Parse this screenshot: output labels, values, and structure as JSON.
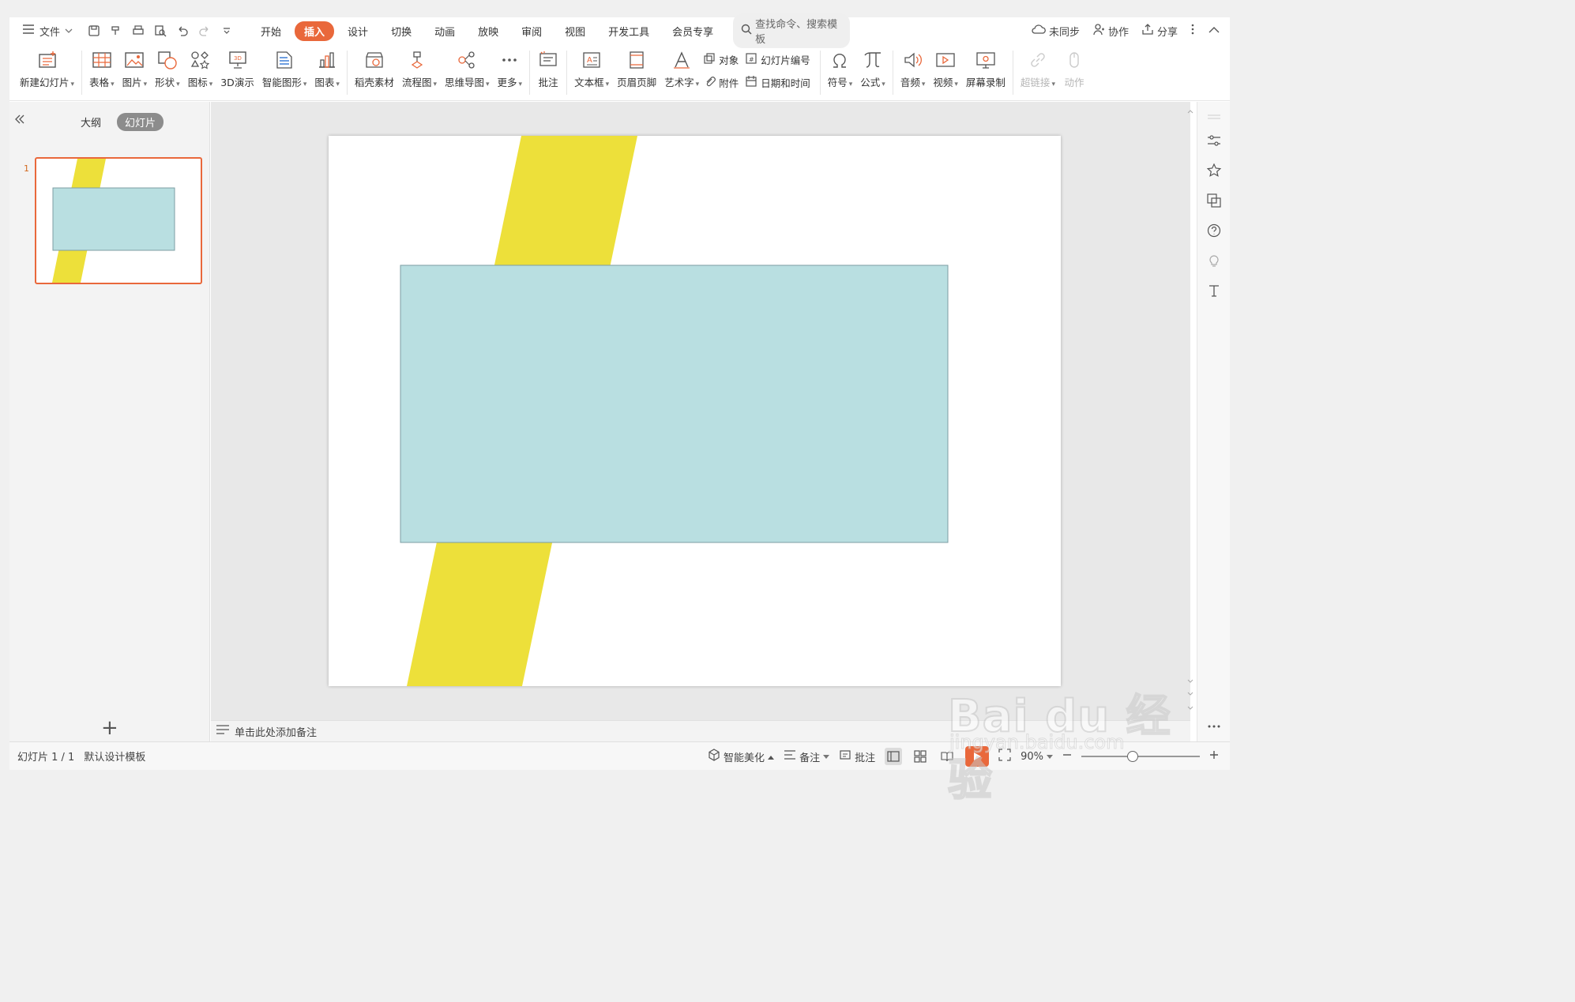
{
  "menubar": {
    "file_label": "文件",
    "tabs": [
      {
        "label": "开始",
        "active": false
      },
      {
        "label": "插入",
        "active": true
      },
      {
        "label": "设计",
        "active": false
      },
      {
        "label": "切换",
        "active": false
      },
      {
        "label": "动画",
        "active": false
      },
      {
        "label": "放映",
        "active": false
      },
      {
        "label": "审阅",
        "active": false
      },
      {
        "label": "视图",
        "active": false
      },
      {
        "label": "开发工具",
        "active": false
      },
      {
        "label": "会员专享",
        "active": false
      }
    ],
    "search_placeholder": "查找命令、搜索模板",
    "sync_label": "未同步",
    "collab_label": "协作",
    "share_label": "分享"
  },
  "ribbon": {
    "new_slide": "新建幻灯片",
    "table": "表格",
    "picture": "图片",
    "shape": "形状",
    "icon": "图标",
    "demo3d": "3D演示",
    "smartart": "智能图形",
    "chart": "图表",
    "material": "稻壳素材",
    "flowchart": "流程图",
    "mindmap": "思维导图",
    "more": "更多",
    "comment": "批注",
    "textbox": "文本框",
    "header_footer": "页眉页脚",
    "wordart": "艺术字",
    "object": "对象",
    "slide_number": "幻灯片编号",
    "attachment": "附件",
    "datetime": "日期和时间",
    "symbol": "符号",
    "formula": "公式",
    "audio": "音频",
    "video": "视频",
    "screen_record": "屏幕录制",
    "hyperlink": "超链接",
    "action": "动作"
  },
  "leftpanel": {
    "outline_tab": "大纲",
    "slides_tab": "幻灯片",
    "slide_number": "1"
  },
  "slide": {
    "stripe_color": "#ede03a",
    "rect_fill": "#b9dfe1",
    "rect_border": "#7d9ea3"
  },
  "notes": {
    "placeholder": "单击此处添加备注"
  },
  "statusbar": {
    "slide_info": "幻灯片 1 / 1",
    "template": "默认设计模板",
    "beautify": "智能美化",
    "notes": "备注",
    "comments": "批注",
    "zoom": "90%"
  },
  "watermark": {
    "brand": "Bai du 经验",
    "url": "jingyan.baidu.com"
  },
  "colors": {
    "accent": "#e9683b"
  }
}
